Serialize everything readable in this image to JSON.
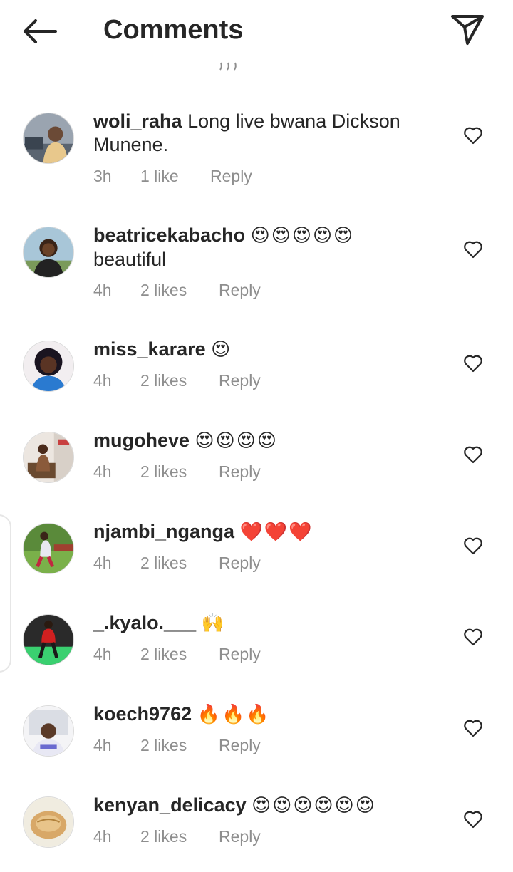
{
  "header": {
    "title": "Comments",
    "back_icon": "arrow-left-icon",
    "share_icon": "paper-plane-icon"
  },
  "comments": [
    {
      "username": "woli_raha",
      "text": "Long live bwana Dickson Munene.",
      "emoji": "",
      "time": "3h",
      "likes": "1 like",
      "reply": "Reply"
    },
    {
      "username": "beatricekabacho",
      "text": "beautiful",
      "emoji": "😍😍😍😍😍",
      "time": "4h",
      "likes": "2 likes",
      "reply": "Reply"
    },
    {
      "username": "miss_karare",
      "text": "",
      "emoji": "😍",
      "time": "4h",
      "likes": "2 likes",
      "reply": "Reply"
    },
    {
      "username": "mugoheve",
      "text": "",
      "emoji": "😍😍😍😍",
      "time": "4h",
      "likes": "2 likes",
      "reply": "Reply"
    },
    {
      "username": "njambi_nganga",
      "text": "",
      "emoji": "❤️❤️❤️",
      "time": "4h",
      "likes": "2 likes",
      "reply": "Reply"
    },
    {
      "username": "_.kyalo.___",
      "text": "",
      "emoji": "🙌",
      "time": "4h",
      "likes": "2 likes",
      "reply": "Reply"
    },
    {
      "username": "koech9762",
      "text": "",
      "emoji": "🔥🔥🔥",
      "time": "4h",
      "likes": "2 likes",
      "reply": "Reply"
    },
    {
      "username": "kenyan_delicacy",
      "text": "",
      "emoji": "😍😍😍😍😍😍",
      "time": "4h",
      "likes": "2 likes",
      "reply": "Reply"
    }
  ],
  "colors": {
    "text": "#262626",
    "meta": "#8e8e8e",
    "divider": "#dbdbdb"
  }
}
